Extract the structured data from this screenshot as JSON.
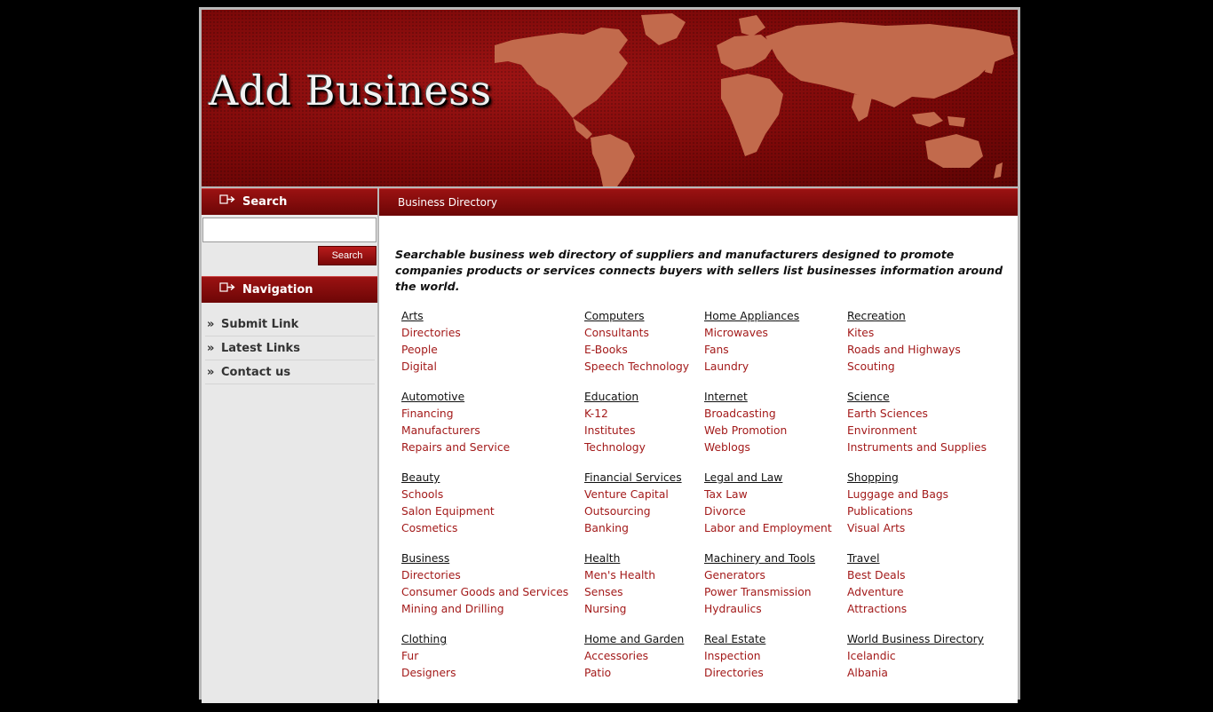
{
  "site": {
    "title": "Add Business"
  },
  "sidebar": {
    "search_heading": "Search",
    "search_value": "",
    "search_button": "Search",
    "nav_heading": "Navigation",
    "nav_items": [
      {
        "label": "Submit Link"
      },
      {
        "label": "Latest Links"
      },
      {
        "label": "Contact us"
      }
    ]
  },
  "main": {
    "bar_title": "Business Directory",
    "intro": "Searchable business web directory of suppliers and manufacturers designed to promote companies products or services connects buyers with sellers list businesses information around the world."
  },
  "categories": [
    [
      {
        "name": "Arts",
        "subs": [
          "Directories",
          "People",
          "Digital"
        ]
      },
      {
        "name": "Automotive",
        "subs": [
          "Financing",
          "Manufacturers",
          "Repairs and Service"
        ]
      },
      {
        "name": "Beauty",
        "subs": [
          "Schools",
          "Salon Equipment",
          "Cosmetics"
        ]
      },
      {
        "name": "Business",
        "subs": [
          "Directories",
          "Consumer Goods and Services",
          "Mining and Drilling"
        ]
      },
      {
        "name": "Clothing",
        "subs": [
          "Fur",
          "Designers"
        ]
      }
    ],
    [
      {
        "name": "Computers",
        "subs": [
          "Consultants",
          "E-Books",
          "Speech Technology"
        ]
      },
      {
        "name": "Education",
        "subs": [
          "K-12",
          "Institutes",
          "Technology"
        ]
      },
      {
        "name": "Financial Services",
        "subs": [
          "Venture Capital",
          "Outsourcing",
          "Banking"
        ]
      },
      {
        "name": "Health",
        "subs": [
          "Men's Health",
          "Senses",
          "Nursing"
        ]
      },
      {
        "name": "Home and Garden",
        "subs": [
          "Accessories",
          "Patio"
        ]
      }
    ],
    [
      {
        "name": "Home Appliances",
        "subs": [
          "Microwaves",
          "Fans",
          "Laundry"
        ]
      },
      {
        "name": "Internet",
        "subs": [
          "Broadcasting",
          "Web Promotion",
          "Weblogs"
        ]
      },
      {
        "name": "Legal and Law",
        "subs": [
          "Tax Law",
          "Divorce",
          "Labor and Employment"
        ]
      },
      {
        "name": "Machinery and Tools",
        "subs": [
          "Generators",
          "Power Transmission",
          "Hydraulics"
        ]
      },
      {
        "name": "Real Estate",
        "subs": [
          "Inspection",
          "Directories"
        ]
      }
    ],
    [
      {
        "name": "Recreation",
        "subs": [
          "Kites",
          "Roads and Highways",
          "Scouting"
        ]
      },
      {
        "name": "Science",
        "subs": [
          "Earth Sciences",
          "Environment",
          "Instruments and Supplies"
        ]
      },
      {
        "name": "Shopping",
        "subs": [
          "Luggage and Bags",
          "Publications",
          "Visual Arts"
        ]
      },
      {
        "name": "Travel",
        "subs": [
          "Best Deals",
          "Adventure",
          "Attractions"
        ]
      },
      {
        "name": "World Business Directory",
        "subs": [
          "Icelandic",
          "Albania"
        ]
      }
    ]
  ]
}
